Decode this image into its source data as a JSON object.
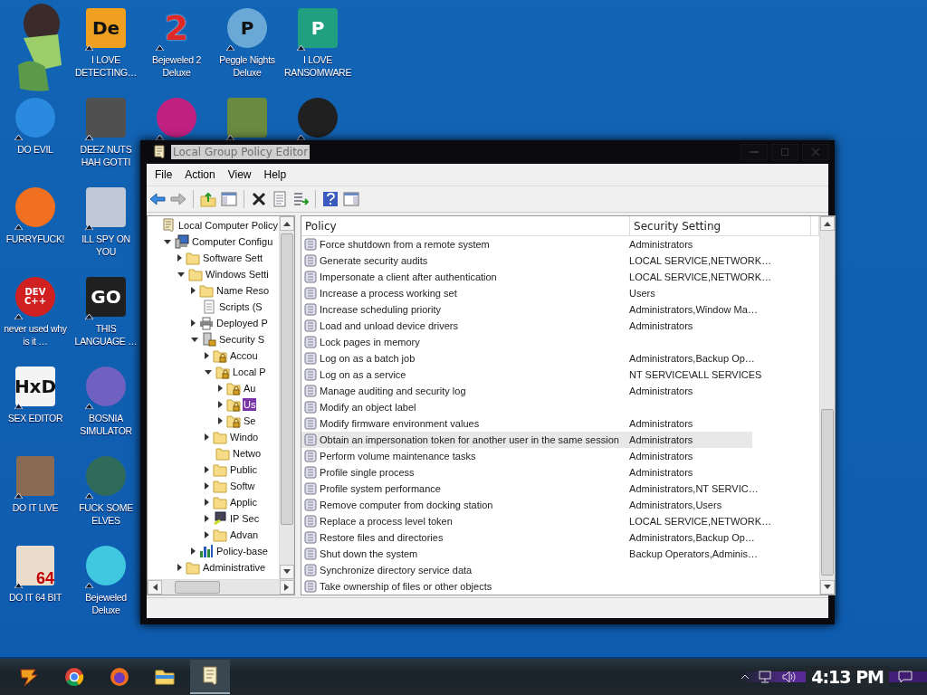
{
  "desktop": {
    "icon_rows": [
      [
        {
          "kind": "sticker",
          "color": "#9ccf6a"
        },
        {
          "kind": "square",
          "label": "I LOVE DETECTING…",
          "glyph": "De",
          "color": "#f0a020"
        },
        {
          "kind": "glyph",
          "label": "Bejeweled 2 Deluxe",
          "glyph": "2",
          "color": "#e02828"
        },
        {
          "kind": "circle",
          "label": "Peggle Nights Deluxe",
          "glyph": "P",
          "color": "#6aa8d8"
        },
        {
          "kind": "square",
          "label": "I LOVE RANSOMWARE",
          "glyph": "P",
          "color": "#20a080"
        }
      ],
      [
        {
          "kind": "circle",
          "label": "DO EVIL",
          "color": "#2a8ae0"
        },
        {
          "kind": "square",
          "label": "DEEZ NUTS HAH GOTTI",
          "color": "#505050"
        },
        {
          "kind": "circle",
          "color": "#c02080"
        },
        {
          "kind": "square",
          "color": "#6a8a40"
        },
        {
          "kind": "circle",
          "color": "#202020"
        }
      ],
      [
        {
          "kind": "circle",
          "label": "FURRYFUCK!",
          "color": "#f07020"
        },
        {
          "kind": "square",
          "label": "ILL SPY ON YOU",
          "color": "#c0c8d8"
        }
      ],
      [
        {
          "kind": "circle",
          "label": "never used why is it …",
          "glyph": "DEV C++",
          "color": "#d02020"
        },
        {
          "kind": "square",
          "label": "THIS LANGUAGE …",
          "glyph": "GO",
          "color": "#202020"
        }
      ],
      [
        {
          "kind": "square",
          "label": "SEX EDITOR",
          "glyph": "HxD",
          "color": "#f4f4f4"
        },
        {
          "kind": "circle",
          "label": "BOSNIA SIMULATOR",
          "color": "#7060c0"
        }
      ],
      [
        {
          "kind": "photo",
          "label": "DO IT LIVE",
          "color": "#8a6a50"
        },
        {
          "kind": "circle",
          "label": "FUCK SOME ELVES",
          "color": "#306a58"
        }
      ],
      [
        {
          "kind": "photo",
          "label": "DO IT 64 BIT",
          "glyph": "64",
          "color": "#ecdccb"
        },
        {
          "kind": "circle",
          "label": "Bejeweled Deluxe",
          "color": "#40c8e0"
        }
      ]
    ]
  },
  "window": {
    "title": "Local Group Policy Editor",
    "menu": [
      "File",
      "Action",
      "View",
      "Help"
    ],
    "tree": [
      {
        "label": "Local Computer Policy",
        "kind": "root",
        "selected": false,
        "children": [
          {
            "label": "Computer Configu",
            "kind": "computer",
            "expanded": true,
            "selected": false,
            "children": [
              {
                "label": "Software Sett",
                "kind": "folder",
                "expanded": false,
                "selected": false
              },
              {
                "label": "Windows Setti",
                "kind": "folder",
                "expanded": true,
                "selected": false,
                "children": [
                  {
                    "label": "Name Reso",
                    "kind": "folder",
                    "expanded": false,
                    "selected": false
                  },
                  {
                    "label": "Scripts (S",
                    "kind": "script",
                    "selected": false
                  },
                  {
                    "label": "Deployed P",
                    "kind": "printer",
                    "expanded": false,
                    "selected": false
                  },
                  {
                    "label": "Security S",
                    "kind": "security",
                    "expanded": true,
                    "selected": false,
                    "children": [
                      {
                        "label": "Accou",
                        "kind": "lockfolder",
                        "expanded": false,
                        "selected": false
                      },
                      {
                        "label": "Local P",
                        "kind": "lockfolder",
                        "expanded": true,
                        "selected": false,
                        "children": [
                          {
                            "label": "Au",
                            "kind": "lockfolder",
                            "expanded": false,
                            "selected": false
                          },
                          {
                            "label": "Us",
                            "kind": "lockfolder",
                            "expanded": false,
                            "selected": true
                          },
                          {
                            "label": "Se",
                            "kind": "lockfolder",
                            "expanded": false,
                            "selected": false
                          }
                        ]
                      },
                      {
                        "label": "Windo",
                        "kind": "folder",
                        "expanded": false,
                        "selected": false
                      },
                      {
                        "label": "Netwo",
                        "kind": "folder",
                        "selected": false
                      },
                      {
                        "label": "Public",
                        "kind": "folder",
                        "expanded": false,
                        "selected": false
                      },
                      {
                        "label": "Softw",
                        "kind": "folder",
                        "expanded": false,
                        "selected": false
                      },
                      {
                        "label": "Applic",
                        "kind": "folder",
                        "expanded": false,
                        "selected": false
                      },
                      {
                        "label": "IP Sec",
                        "kind": "ip",
                        "expanded": false,
                        "selected": false
                      },
                      {
                        "label": "Advan",
                        "kind": "folder",
                        "expanded": false,
                        "selected": false
                      }
                    ]
                  },
                  {
                    "label": "Policy-base",
                    "kind": "chart",
                    "expanded": false,
                    "selected": false
                  }
                ]
              },
              {
                "label": "Administrative",
                "kind": "folder",
                "expanded": false,
                "selected": false
              }
            ]
          }
        ]
      }
    ],
    "list": {
      "columns": [
        "Policy",
        "Security Setting"
      ],
      "rows": [
        {
          "policy": "Force shutdown from a remote system",
          "setting": "Administrators",
          "selected": false
        },
        {
          "policy": "Generate security audits",
          "setting": "LOCAL SERVICE,NETWORK…",
          "selected": false
        },
        {
          "policy": "Impersonate a client after authentication",
          "setting": "LOCAL SERVICE,NETWORK…",
          "selected": false
        },
        {
          "policy": "Increase a process working set",
          "setting": "Users",
          "selected": false
        },
        {
          "policy": "Increase scheduling priority",
          "setting": "Administrators,Window Ma…",
          "selected": false
        },
        {
          "policy": "Load and unload device drivers",
          "setting": "Administrators",
          "selected": false
        },
        {
          "policy": "Lock pages in memory",
          "selected": false
        },
        {
          "policy": "Log on as a batch job",
          "setting": "Administrators,Backup Op…",
          "selected": false
        },
        {
          "policy": "Log on as a service",
          "setting": "NT SERVICE\\ALL SERVICES",
          "selected": false
        },
        {
          "policy": "Manage auditing and security log",
          "setting": "Administrators",
          "selected": false
        },
        {
          "policy": "Modify an object label",
          "selected": false
        },
        {
          "policy": "Modify firmware environment values",
          "setting": "Administrators",
          "selected": false
        },
        {
          "policy": "Obtain an impersonation token for another user in the same session",
          "setting": "Administrators",
          "selected": true
        },
        {
          "policy": "Perform volume maintenance tasks",
          "setting": "Administrators",
          "selected": false
        },
        {
          "policy": "Profile single process",
          "setting": "Administrators",
          "selected": false
        },
        {
          "policy": "Profile system performance",
          "setting": "Administrators,NT SERVIC…",
          "selected": false
        },
        {
          "policy": "Remove computer from docking station",
          "setting": "Administrators,Users",
          "selected": false
        },
        {
          "policy": "Replace a process level token",
          "setting": "LOCAL SERVICE,NETWORK…",
          "selected": false
        },
        {
          "policy": "Restore files and directories",
          "setting": "Administrators,Backup Op…",
          "selected": false
        },
        {
          "policy": "Shut down the system",
          "setting": "Backup Operators,Adminis…",
          "selected": false
        },
        {
          "policy": "Synchronize directory service data",
          "selected": false
        },
        {
          "policy": "Take ownership of files or other objects",
          "selected": false
        }
      ]
    }
  },
  "taskbar": {
    "apps": [
      {
        "kind": "start",
        "selected": false
      },
      {
        "kind": "chrome",
        "selected": false
      },
      {
        "kind": "firefox",
        "selected": false
      },
      {
        "kind": "explorer",
        "selected": false
      },
      {
        "kind": "policy",
        "selected": true
      }
    ],
    "clock": "4:13 PM"
  }
}
